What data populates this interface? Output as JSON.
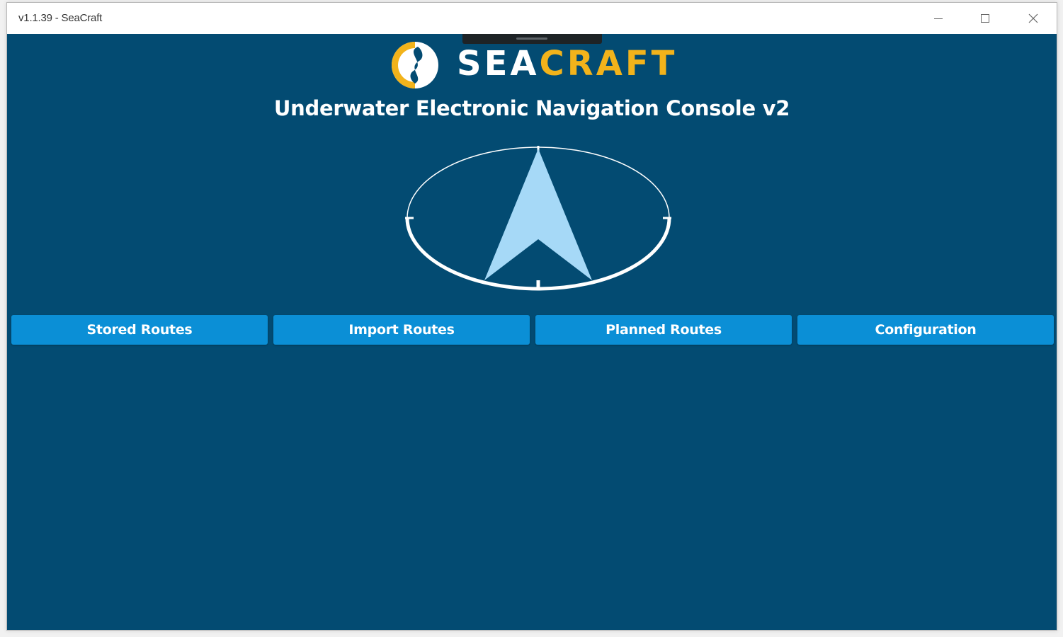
{
  "window": {
    "title": "v1.1.39 - SeaCraft",
    "minimize_icon": "minimize-icon",
    "maximize_icon": "maximize-icon",
    "close_icon": "close-icon"
  },
  "header": {
    "logo_word_sea": "SEA",
    "logo_word_craft": "CRAFT",
    "logo_icon": "seacraft-logo-icon",
    "title": "Underwater Electronic Navigation Console v2"
  },
  "compass": {
    "icon": "compass-heading-arrow-icon"
  },
  "nav": {
    "buttons": [
      {
        "label": "Stored Routes"
      },
      {
        "label": "Import Routes"
      },
      {
        "label": "Planned Routes"
      },
      {
        "label": "Configuration"
      }
    ]
  },
  "colors": {
    "background": "#034b72",
    "button": "#0b8fd6",
    "accent_yellow": "#f2b31b",
    "arrow": "#a6d9f7",
    "text": "#ffffff"
  }
}
